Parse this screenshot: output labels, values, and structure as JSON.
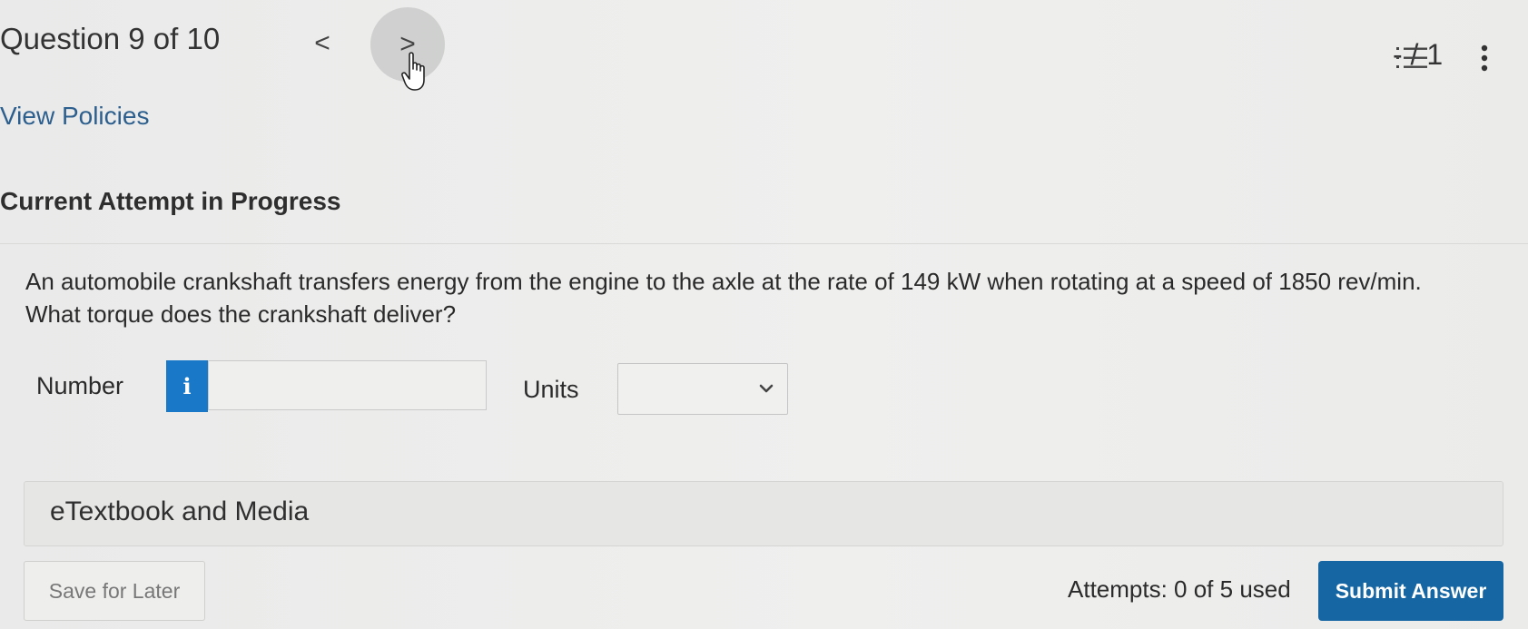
{
  "header": {
    "question_progress": "Question 9 of 10",
    "prev_label": "<",
    "next_label": ">",
    "score": "- / 1"
  },
  "links": {
    "view_policies": "View Policies"
  },
  "attempt_heading": "Current Attempt in Progress",
  "question": {
    "line1": "An automobile crankshaft transfers energy from the engine to the axle at the rate of 149 kW when rotating at a speed of 1850 rev/min.",
    "line2": "What torque does the crankshaft deliver?"
  },
  "answer": {
    "number_label": "Number",
    "info_label": "i",
    "number_value": "",
    "units_label": "Units",
    "units_selected": ""
  },
  "etextbook_label": "eTextbook and Media",
  "footer": {
    "save_label": "Save for Later",
    "attempts_text": "Attempts: 0 of 5 used",
    "submit_label": "Submit Answer"
  },
  "icons": {
    "prev": "chevron-left-icon",
    "next": "chevron-right-icon",
    "cursor": "hand-pointer-icon",
    "question_list": "numbered-list-icon",
    "more": "more-vertical-icon",
    "info": "info-icon",
    "dropdown": "chevron-down-icon"
  },
  "colors": {
    "link": "#2d5f8e",
    "info_button": "#1979c8",
    "submit_button": "#1566a3",
    "background": "#ecedec"
  }
}
